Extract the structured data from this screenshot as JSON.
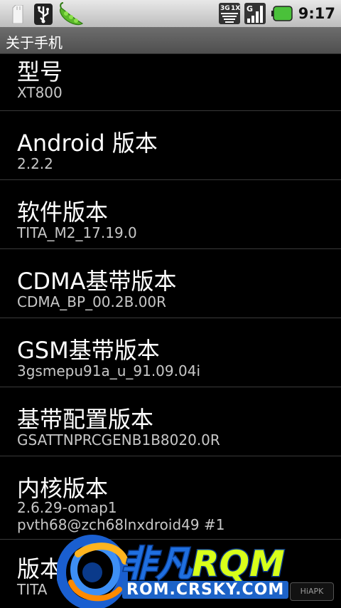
{
  "status_bar": {
    "network_label": "3G 1X",
    "signal_label": "G",
    "time": "9:17",
    "icons": [
      "sd-card-icon",
      "usb-icon",
      "pea-pod-icon",
      "network-3g-icon",
      "signal-icon",
      "battery-icon"
    ],
    "battery_color": "#4ac13a"
  },
  "title": "关于手机",
  "items": [
    {
      "title": "型号",
      "summary": "XT800"
    },
    {
      "title": "Android 版本",
      "summary": "2.2.2"
    },
    {
      "title": "软件版本",
      "summary": "TITA_M2_17.19.0"
    },
    {
      "title": "CDMA基带版本",
      "summary": "CDMA_BP_00.2B.00R"
    },
    {
      "title": "GSM基带版本",
      "summary": "3gsmepu91a_u_91.09.04i"
    },
    {
      "title": "基带配置版本",
      "summary": "GSATTNPRCGENB1B8020.0R"
    },
    {
      "title": "内核版本",
      "summary": "2.6.29-omap1",
      "summary2": "pvth68@zch68lnxdroid49 #1"
    },
    {
      "title": "版本",
      "summary": "TITA"
    }
  ],
  "watermark": {
    "title_a": "非凡",
    "title_b": "RQM",
    "url": "ROM.CRSKY.COM",
    "badge": "HiAPK"
  }
}
